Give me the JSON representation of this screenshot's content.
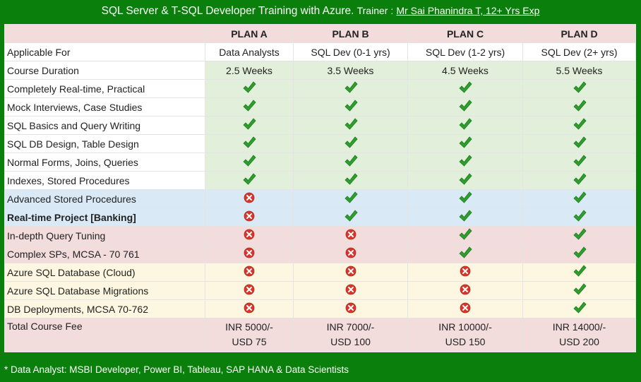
{
  "header": {
    "title": "SQL Server & T-SQL Developer Training with Azure.",
    "trainer_prefix": "Trainer :",
    "trainer_link": "Mr Sai Phanindra T, 12+ Yrs Exp"
  },
  "plans": [
    "PLAN A",
    "PLAN B",
    "PLAN C",
    "PLAN D"
  ],
  "applicable": {
    "label": "Applicable For",
    "values": [
      "Data Analysts",
      "SQL Dev (0-1 yrs)",
      "SQL Dev (1-2 yrs)",
      "SQL Dev (2+ yrs)"
    ]
  },
  "duration": {
    "label": "Course Duration",
    "values": [
      "2.5 Weeks",
      "3.5 Weeks",
      "4.5 Weeks",
      "5.5 Weeks"
    ]
  },
  "features": [
    {
      "label": "Completely Real-time, Practical",
      "bold": false,
      "band": "green",
      "values": [
        true,
        true,
        true,
        true
      ]
    },
    {
      "label": "Mock Interviews, Case Studies",
      "bold": false,
      "band": "green",
      "values": [
        true,
        true,
        true,
        true
      ]
    },
    {
      "label": "SQL Basics and Query Writing",
      "bold": false,
      "band": "green",
      "values": [
        true,
        true,
        true,
        true
      ]
    },
    {
      "label": "SQL DB Design, Table Design",
      "bold": false,
      "band": "green",
      "values": [
        true,
        true,
        true,
        true
      ]
    },
    {
      "label": "Normal Forms, Joins, Queries",
      "bold": false,
      "band": "green",
      "values": [
        true,
        true,
        true,
        true
      ]
    },
    {
      "label": "Indexes, Stored Procedures",
      "bold": false,
      "band": "green",
      "values": [
        true,
        true,
        true,
        true
      ]
    },
    {
      "label": "Advanced Stored Procedures",
      "bold": false,
      "band": "blue",
      "values": [
        false,
        true,
        true,
        true
      ]
    },
    {
      "label": "Real-time Project [Banking]",
      "bold": true,
      "band": "blue",
      "values": [
        false,
        true,
        true,
        true
      ]
    },
    {
      "label": "In-depth Query Tuning",
      "bold": false,
      "band": "pink",
      "values": [
        false,
        false,
        true,
        true
      ]
    },
    {
      "label": "Complex SPs, MCSA - 70 761",
      "bold": false,
      "band": "pink",
      "values": [
        false,
        false,
        true,
        true
      ]
    },
    {
      "label": "Azure SQL Database (Cloud)",
      "bold": false,
      "band": "yellow",
      "values": [
        false,
        false,
        false,
        true
      ]
    },
    {
      "label": "Azure SQL Database Migrations",
      "bold": false,
      "band": "yellow",
      "values": [
        false,
        false,
        false,
        true
      ]
    },
    {
      "label": "DB Deployments, MCSA 70-762",
      "bold": false,
      "band": "yellow",
      "values": [
        false,
        false,
        false,
        true
      ]
    }
  ],
  "fee": {
    "label": "Total Course Fee",
    "values": [
      {
        "inr": "INR 5000/-",
        "usd": "USD 75"
      },
      {
        "inr": "INR 7000/-",
        "usd": "USD 100"
      },
      {
        "inr": "INR 10000/-",
        "usd": "USD 150"
      },
      {
        "inr": "INR 14000/-",
        "usd": "USD 200"
      }
    ]
  },
  "footnote": "* Data Analyst: MSBI Developer, Power BI, Tableau, SAP HANA & Data Scientists",
  "colors": {
    "background": "#0b7f0b",
    "check": "#2e9e2e",
    "cross": "#d9362b"
  }
}
